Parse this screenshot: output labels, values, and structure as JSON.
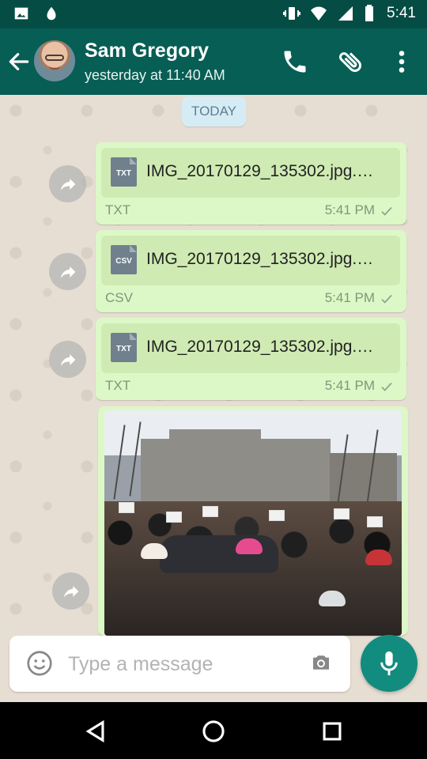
{
  "status_bar": {
    "time": "5:41",
    "icons": [
      "image-icon",
      "drop-icon",
      "vibrate-icon",
      "wifi-icon",
      "signal-icon",
      "battery-icon"
    ]
  },
  "header": {
    "contact_name": "Sam Gregory",
    "last_seen": "yesterday at 11:40 AM",
    "actions": [
      "call-icon",
      "attachment-icon",
      "more-icon"
    ]
  },
  "chat": {
    "date_label": "TODAY",
    "messages": [
      {
        "file_name": "IMG_20170129_135302.jpg.…",
        "icon_label": "TXT",
        "file_type": "TXT",
        "time": "5:41 PM"
      },
      {
        "file_name": "IMG_20170129_135302.jpg.…",
        "icon_label": "CSV",
        "file_type": "CSV",
        "time": "5:41 PM"
      },
      {
        "file_name": "IMG_20170129_135302.jpg.…",
        "icon_label": "TXT",
        "file_type": "TXT",
        "time": "5:41 PM"
      }
    ]
  },
  "composer": {
    "placeholder": "Type a message",
    "value": ""
  },
  "navigation": {
    "buttons": [
      "back-icon",
      "home-icon",
      "recents-icon"
    ]
  },
  "colors": {
    "status_bar": "#054d44",
    "app_bar": "#075e54",
    "bubble": "#dcf8c6",
    "mic_button": "#128c7e"
  }
}
